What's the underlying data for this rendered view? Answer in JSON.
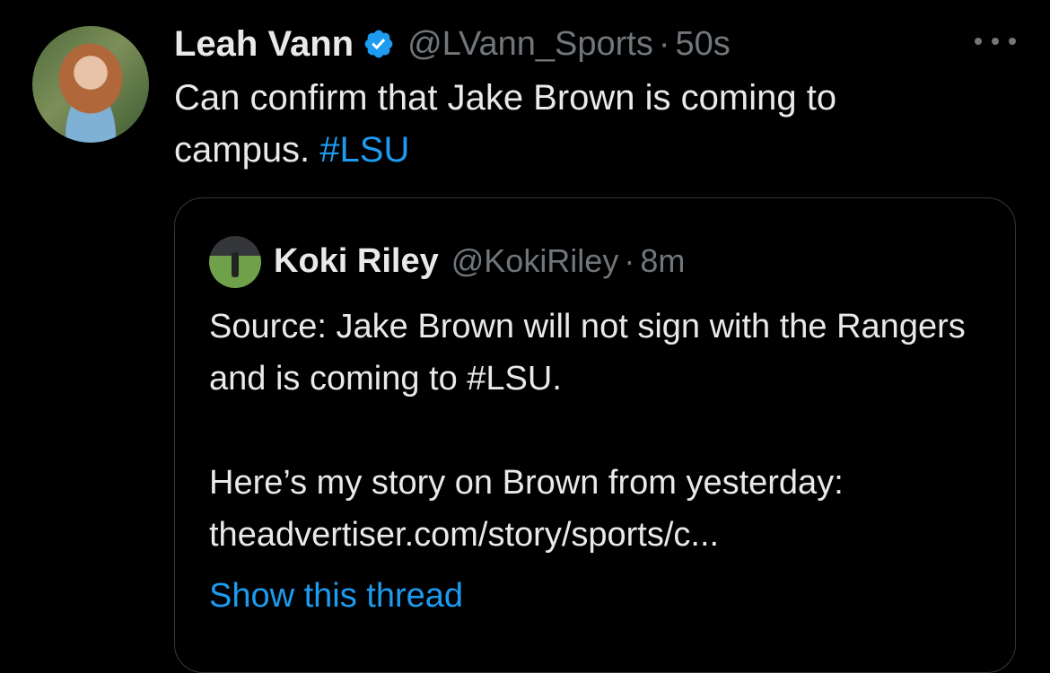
{
  "tweet": {
    "author_name": "Leah Vann",
    "handle": "@LVann_Sports",
    "separator": "·",
    "time": "50s",
    "text_before": "Can confirm that Jake Brown is coming to campus. ",
    "hashtag": "#LSU",
    "verified_icon": "verified-badge-icon",
    "more_icon": "more-options-icon"
  },
  "quoted_tweet": {
    "author_name": "Koki Riley",
    "handle": "@KokiRiley",
    "separator": "·",
    "time": "8m",
    "line1": "Source: Jake Brown will not sign with the Rangers and is coming to #LSU.",
    "line2": "Here’s my story on Brown from yesterday:",
    "line3": "theadvertiser.com/story/sports/c...",
    "show_thread": "Show this thread"
  },
  "colors": {
    "background": "#000000",
    "text": "#e7e9ea",
    "secondary": "#71767b",
    "accent": "#1d9bf0",
    "border": "#333639"
  }
}
